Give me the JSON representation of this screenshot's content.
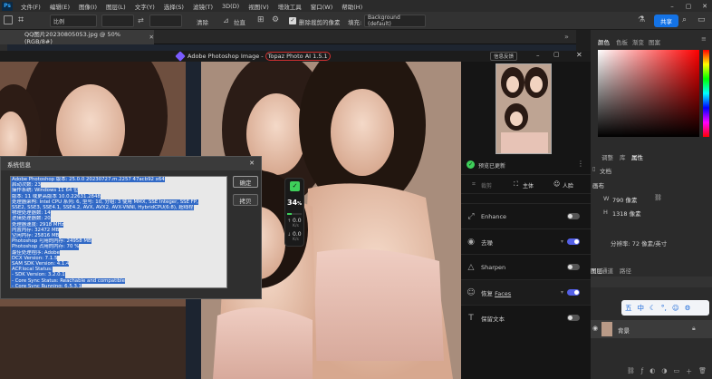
{
  "menubar": {
    "logo": "Ps",
    "items": [
      "文件(F)",
      "编辑(E)",
      "图像(I)",
      "图层(L)",
      "文字(Y)",
      "选择(S)",
      "滤镜(T)",
      "3D(D)",
      "视图(V)",
      "增效工具",
      "窗口(W)",
      "帮助(H)"
    ]
  },
  "options": {
    "ratio": "比例",
    "clear": "清除",
    "straighten": "拉直",
    "delete_cropped": "删除裁剪的像素",
    "fill_label": "填充:",
    "fill_value": "Background (default)",
    "share": "共享"
  },
  "document": {
    "tab_title": "QQ图片20230805053.jpg @ 50%(RGB/8#)"
  },
  "topaz": {
    "title_app": "Adobe Photoshop Image - ",
    "title_plugin": "Topaz Photo AI 1.5.1",
    "feedback": "信息反馈",
    "status": "预览已更新",
    "tabs": [
      "裁剪",
      "主体",
      "人脸"
    ],
    "rows": [
      {
        "label": "Enhance",
        "enabled": false
      },
      {
        "label": "去噪",
        "enabled": true
      },
      {
        "label": "Sharpen",
        "enabled": false
      },
      {
        "label_prefix": "恢复",
        "label": "Faces",
        "enabled": true
      },
      {
        "label": "保留文本",
        "enabled": false
      }
    ],
    "progress": {
      "percent": "34",
      "percent_sign": "%",
      "r1": "0.0",
      "r1u": "K/s",
      "r2": "0.0",
      "r2u": "K/s",
      "value": 0.34
    }
  },
  "dialog": {
    "title": "系统信息",
    "ok": "确定",
    "copy": "拷贝",
    "lines": [
      "Adobe Photoshop 版本: 25.0.0 20230727.m.2257 47acb92  x64",
      "启动次数: 23",
      "操作系统: Windows 11 64 位",
      "版本: 11 或更高版本 10.0.22631.2848",
      "处理器架构: Intel CPU 系列: 6, 型号: 10, 分组: 3 使用 MMX, SSE Integer, SSE FP,",
      "SSE2, SSE3, SSE4.1, SSE4.2, AVX, AVX2, AVX-VNNI, HybridCPU(6:8), 超线程",
      "物理处理器数: 14",
      "逻辑处理器数: 20",
      "处理器速度: 2918 MHz",
      "内置内存: 32472 MB",
      "空闲内存: 25816 MB",
      "Photoshop 可用的内存: 24958 MB",
      "Photoshop 占用的内存: 70 %",
      "最佳处理程序: Adobe",
      "DCX Version: 7.1.5",
      "SAM SDK Version: 4.1.4",
      "ACP.local Status:",
      "  - SDK Version: 3.2.0.1",
      "  - Core Sync Status: Reachable and compatible",
      "  - Core Sync Running: 6.5.3.1",
      "  - Min Core Sync Required: 4.3.66.28"
    ]
  },
  "ps_right": {
    "top_tabs": [
      "颜色",
      "色板",
      "渐变",
      "图案"
    ],
    "mid_tabs": [
      "调整",
      "库",
      "属性"
    ],
    "doc_label": "文档",
    "section": "画布",
    "w_label": "W",
    "w_value": "790 像素",
    "h_label": "H",
    "h_value": "1318 像素",
    "resolution": "分辨率: 72 像素/英寸",
    "layer_tabs": [
      "图层",
      "通道",
      "路径"
    ],
    "ime": [
      "五",
      "中"
    ],
    "layer_name": "背景"
  },
  "colors": {
    "accent": "#5460e8",
    "share": "#1473e6",
    "selection": "#3169c6",
    "green": "#3ecf5a"
  }
}
